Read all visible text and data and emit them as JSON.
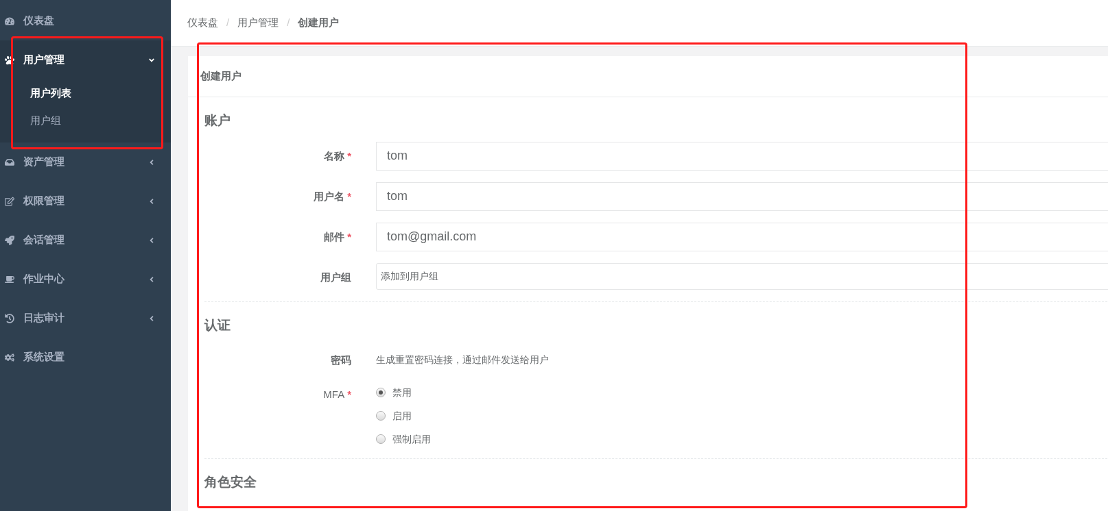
{
  "sidebar": {
    "items": [
      {
        "label": "仪表盘",
        "expanded": false,
        "has_arrow": false
      },
      {
        "label": "用户管理",
        "expanded": true,
        "has_arrow": true,
        "children": [
          {
            "label": "用户列表",
            "selected": true
          },
          {
            "label": "用户组",
            "selected": false
          }
        ]
      },
      {
        "label": "资产管理",
        "expanded": false,
        "has_arrow": true
      },
      {
        "label": "权限管理",
        "expanded": false,
        "has_arrow": true
      },
      {
        "label": "会话管理",
        "expanded": false,
        "has_arrow": true
      },
      {
        "label": "作业中心",
        "expanded": false,
        "has_arrow": true
      },
      {
        "label": "日志审计",
        "expanded": false,
        "has_arrow": true
      },
      {
        "label": "系统设置",
        "expanded": false,
        "has_arrow": false
      }
    ]
  },
  "breadcrumb": {
    "separator": "/",
    "items": [
      "仪表盘",
      "用户管理",
      "创建用户"
    ]
  },
  "card": {
    "title": "创建用户",
    "sections": [
      {
        "title": "账户",
        "fields": [
          {
            "kind": "input",
            "label": "名称",
            "required_mark": "*",
            "value": "tom"
          },
          {
            "kind": "input",
            "label": "用户名",
            "required_mark": "*",
            "value": "tom"
          },
          {
            "kind": "input",
            "label": "邮件",
            "required_mark": "*",
            "value": "tom@gmail.com"
          },
          {
            "kind": "select",
            "label": "用户组",
            "placeholder": "添加到用户组"
          }
        ]
      },
      {
        "title": "认证",
        "fields": [
          {
            "kind": "text",
            "label": "密码",
            "text": "生成重置密码连接，通过邮件发送给用户"
          },
          {
            "kind": "radio",
            "label": "MFA",
            "required_mark": "*",
            "options": [
              {
                "label": "禁用",
                "selected": true
              },
              {
                "label": "启用",
                "selected": false
              },
              {
                "label": "强制启用",
                "selected": false
              }
            ]
          }
        ]
      },
      {
        "title": "角色安全"
      }
    ]
  }
}
